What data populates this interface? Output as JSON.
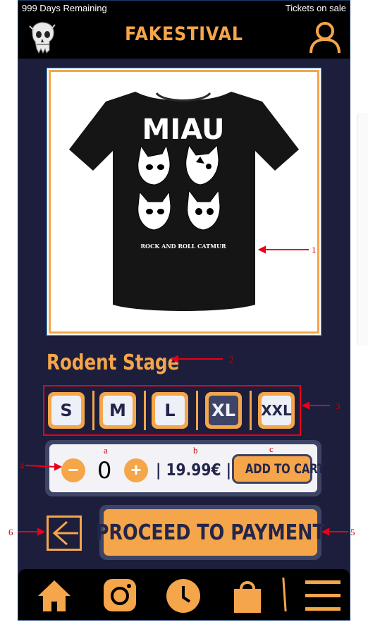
{
  "status": {
    "left": "999 Days Remaining",
    "right": "Tickets on sale"
  },
  "header": {
    "brand": "FAKESTIVAL"
  },
  "product": {
    "shirt_title": "MIAU",
    "shirt_caption": "ROCK AND ROLL CATMUR",
    "name": "Rodent Stage"
  },
  "sizes": [
    {
      "label": "S",
      "selected": false
    },
    {
      "label": "M",
      "selected": false
    },
    {
      "label": "L",
      "selected": false
    },
    {
      "label": "XL",
      "selected": true
    },
    {
      "label": "XXL",
      "selected": false
    }
  ],
  "cart": {
    "minus": "−",
    "quantity": "0",
    "plus": "+",
    "price": "| 19.99€ |",
    "add_label": "ADD TO CART"
  },
  "actions": {
    "proceed_label": "PROCEED TO PAYMENT"
  },
  "nav": {
    "items": [
      "home-icon",
      "instagram-icon",
      "clock-icon",
      "shopping-bag-icon",
      "menu-icon"
    ]
  },
  "annotations": {
    "n1": "1",
    "n2": "2",
    "n3": "3",
    "n4": "4",
    "n5": "5",
    "n6": "6",
    "a": "a",
    "b": "b",
    "c": "c"
  },
  "colors": {
    "accent": "#f5a54a",
    "background": "#1c1e3c",
    "panel": "#3d4466",
    "annotation": "#cc0000"
  }
}
